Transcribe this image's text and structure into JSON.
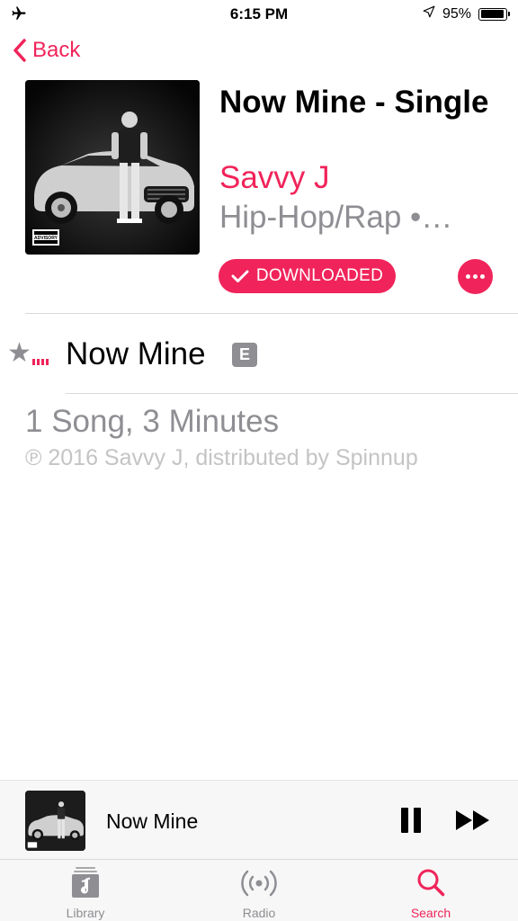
{
  "status_bar": {
    "time": "6:15 PM",
    "battery": "95%",
    "battery_level": 0.95,
    "icons": [
      "airplane-icon",
      "location-arrow-icon",
      "battery-icon"
    ]
  },
  "nav": {
    "back_label": "Back"
  },
  "album": {
    "title": "Now Mine - Single",
    "artist": "Savvy J",
    "genre": "Hip-Hop/Rap •…",
    "downloaded_label": "DOWNLOADED",
    "accent_color": "#f0245a",
    "artwork_badge_line1": "PARENTAL",
    "artwork_badge_line2": "ADVISORY",
    "artwork_badge_line3": "EXPLICIT CONTENT"
  },
  "tracks": [
    {
      "name": "Now Mine",
      "explicit_label": "E"
    }
  ],
  "summary": {
    "count_duration": "1 Song, 3 Minutes",
    "copyright": "℗ 2016 Savvy J, distributed by Spinnup"
  },
  "mini_player": {
    "title": "Now Mine"
  },
  "tab_bar": {
    "tabs": [
      {
        "label": "Library",
        "icon": "library-icon",
        "active": false
      },
      {
        "label": "Radio",
        "icon": "radio-icon",
        "active": false
      },
      {
        "label": "Search",
        "icon": "search-icon",
        "active": true
      }
    ]
  }
}
